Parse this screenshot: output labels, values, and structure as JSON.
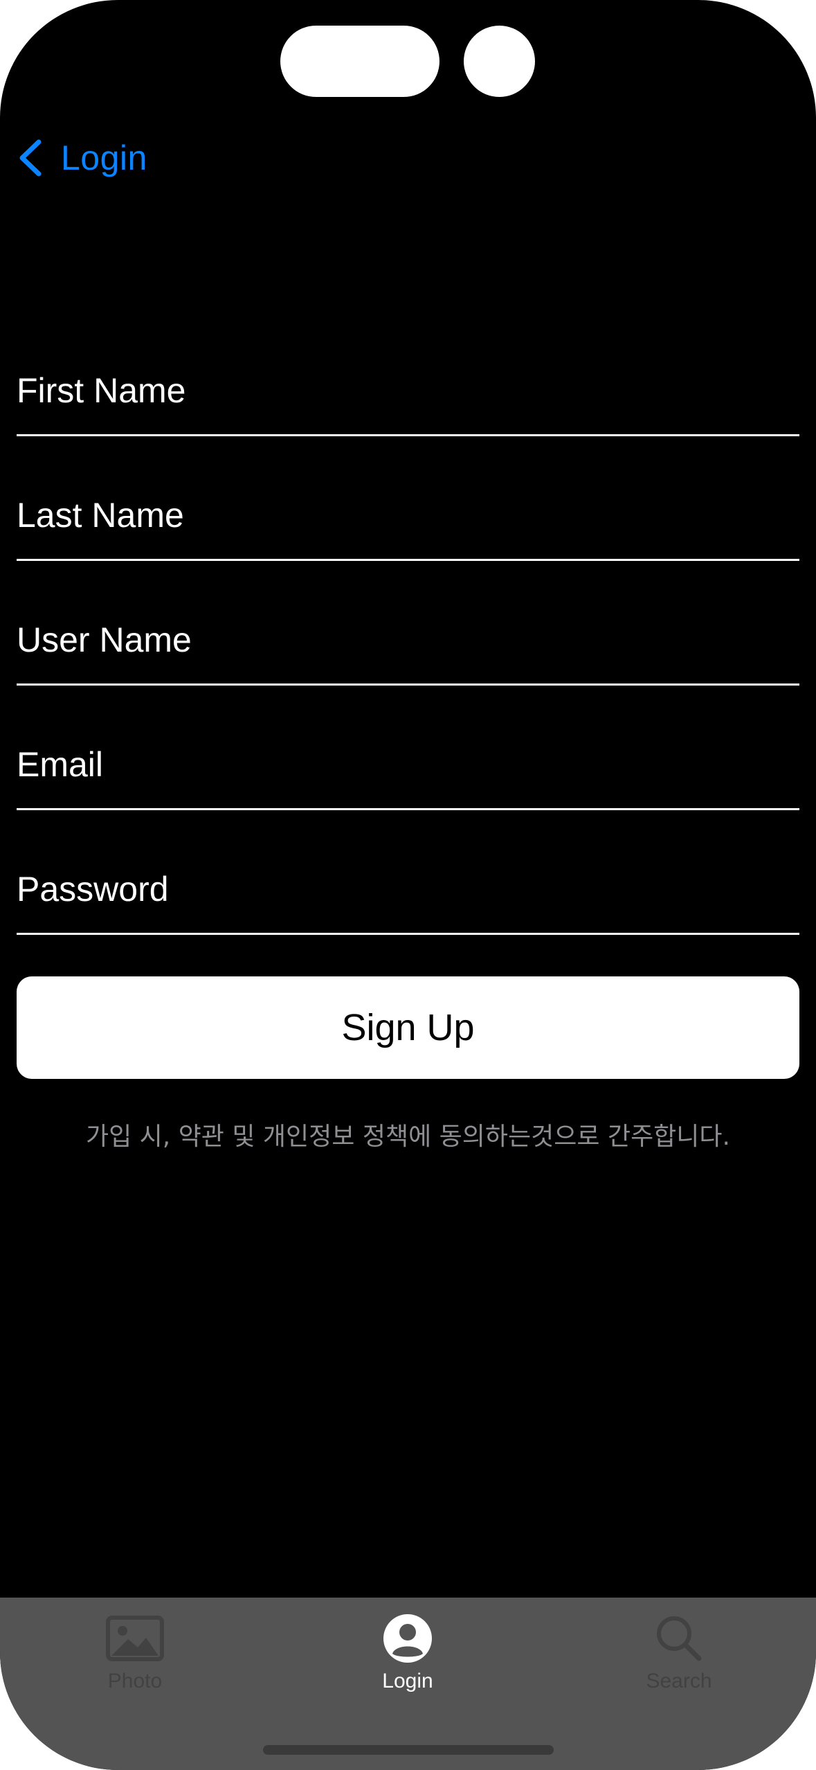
{
  "nav": {
    "back_label": "Login",
    "accent_color": "#0a84ff"
  },
  "form": {
    "first_name_placeholder": "First Name",
    "first_name_value": "",
    "last_name_placeholder": "Last Name",
    "last_name_value": "",
    "user_name_placeholder": "User Name",
    "user_name_value": "",
    "email_placeholder": "Email",
    "email_value": "",
    "password_placeholder": "Password",
    "password_value": ""
  },
  "signup_button": {
    "label": "Sign Up"
  },
  "terms_text": "가입 시, 약관 및 개인정보 정책에 동의하는것으로 간주합니다.",
  "tabbar": {
    "selected": "Login",
    "items": [
      {
        "label": "Photo",
        "icon": "photo-icon",
        "active": false
      },
      {
        "label": "Login",
        "icon": "person-circle-icon",
        "active": true
      },
      {
        "label": "Search",
        "icon": "magnifying-glass-icon",
        "active": false
      }
    ],
    "active_color": "#ffffff",
    "inactive_color": "#424242",
    "background": "#545454"
  }
}
